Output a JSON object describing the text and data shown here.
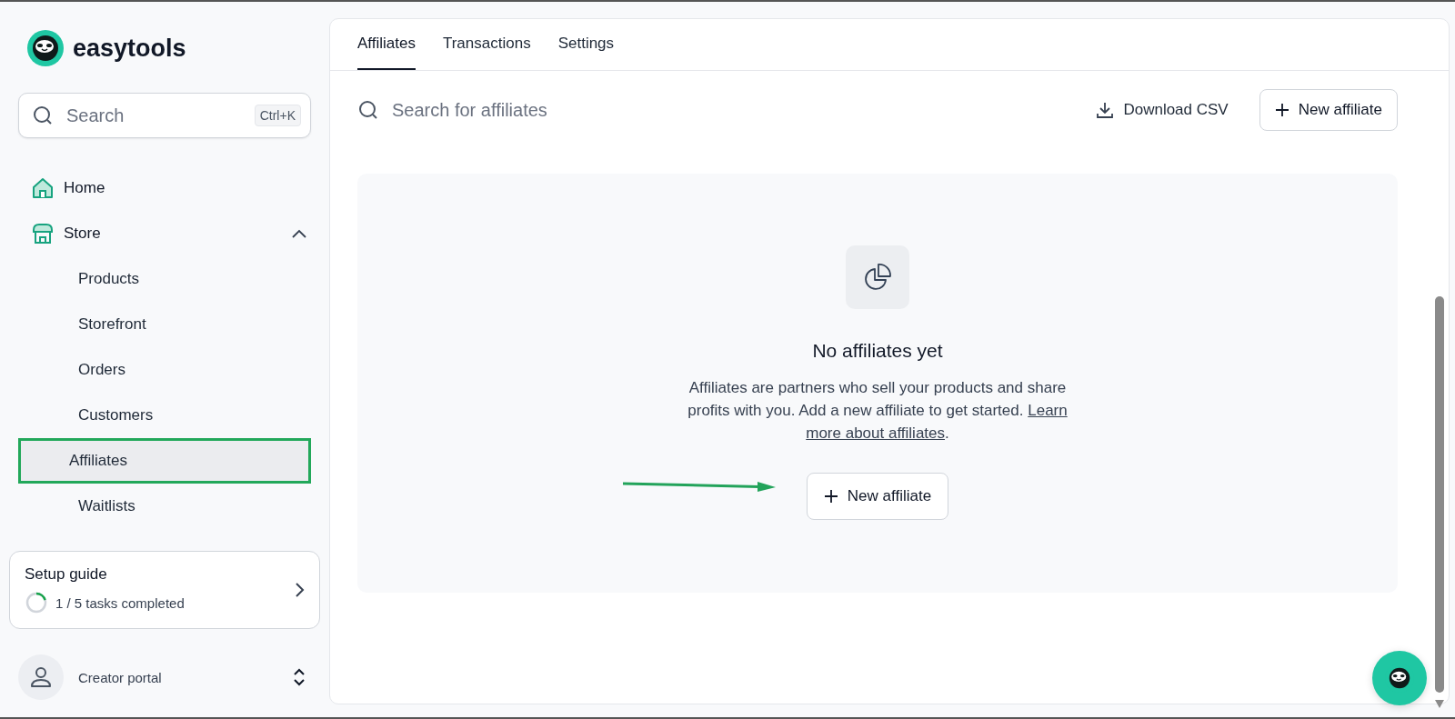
{
  "sidebar": {
    "brand": "easytools",
    "search": {
      "placeholder": "Search",
      "shortcut": "Ctrl+K"
    },
    "items": [
      {
        "label": "Home",
        "kind": "home"
      },
      {
        "label": "Store",
        "kind": "store",
        "expanded": true,
        "children": [
          {
            "label": "Products",
            "selected": false
          },
          {
            "label": "Storefront",
            "selected": false
          },
          {
            "label": "Orders",
            "selected": false
          },
          {
            "label": "Customers",
            "selected": false
          },
          {
            "label": "Affiliates",
            "selected": true
          },
          {
            "label": "Waitlists",
            "selected": false
          }
        ]
      }
    ],
    "setup_guide": {
      "title": "Setup guide",
      "progress": "1 / 5 tasks completed",
      "level": 0.2
    },
    "account": {
      "label": "Creator portal"
    }
  },
  "tabs": [
    {
      "label": "Affiliates",
      "selected": true
    },
    {
      "label": "Transactions",
      "selected": false
    },
    {
      "label": "Settings",
      "selected": false
    }
  ],
  "toolbar": {
    "search": {
      "placeholder": "Search for affiliates"
    },
    "download": "Download CSV",
    "new": "New affiliate"
  },
  "empty_state": {
    "title": "No affiliates yet",
    "text": "Affiliates are partners who sell your products and share profits with you. Add a new affiliate to get started.",
    "link": "more about affiliates",
    "link_first": "Learn",
    "after_link": ".",
    "button": "New affiliate"
  }
}
